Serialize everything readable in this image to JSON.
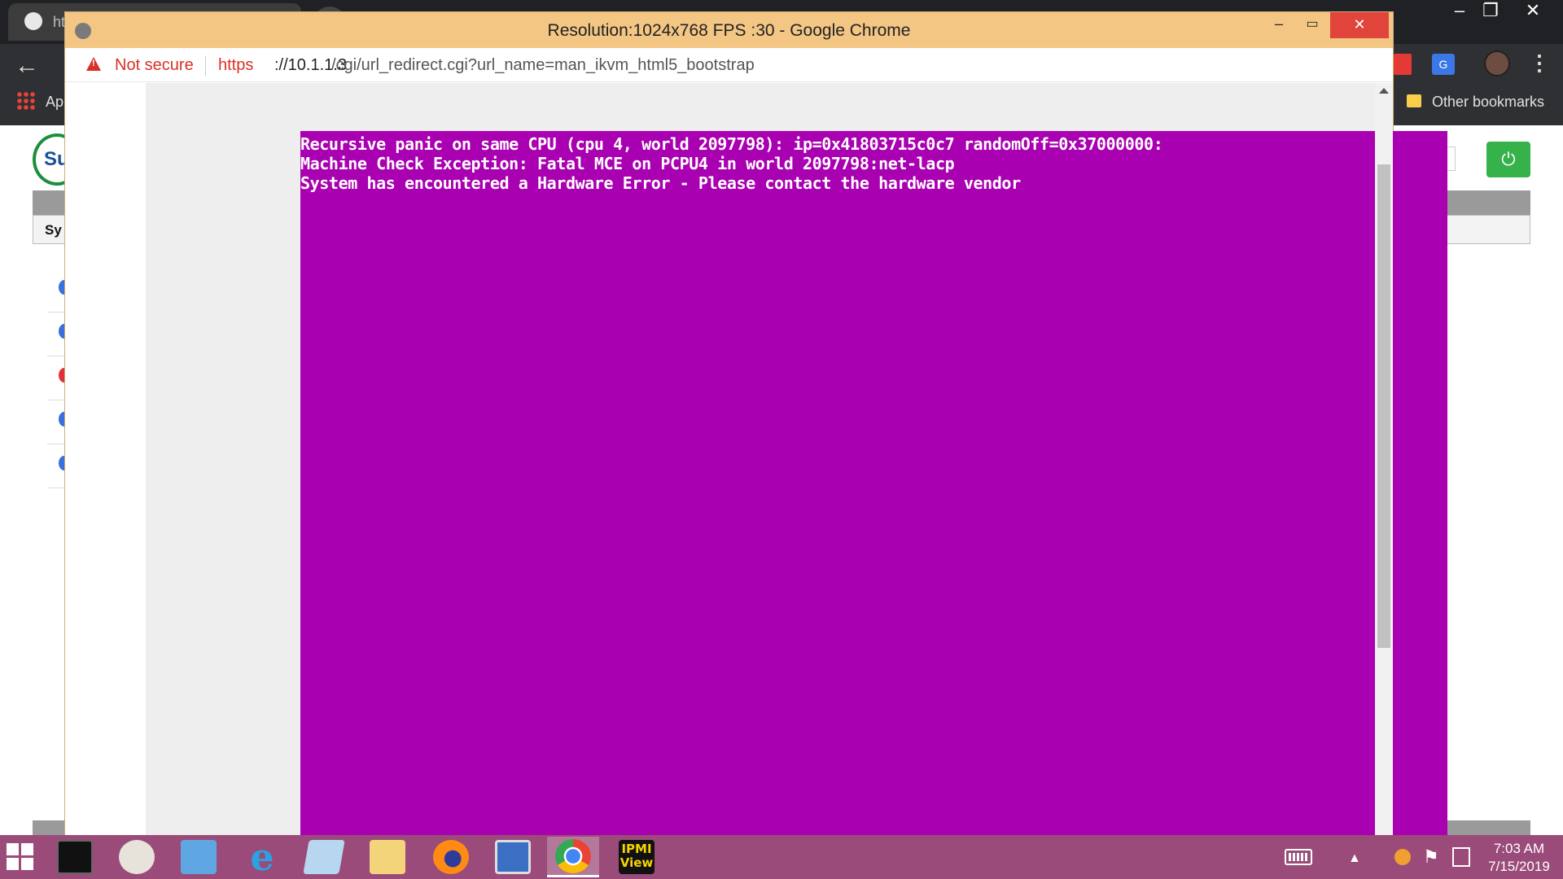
{
  "background_browser": {
    "tab_title": "ht",
    "apps_label": "Ap",
    "other_bookmarks": "Other bookmarks",
    "logo_text": "Su",
    "system_tab_label": "Sy",
    "ext_translate": "G"
  },
  "popup": {
    "title": "Resolution:1024x768 FPS :30 - Google Chrome",
    "minimize_glyph": "–",
    "maximize_glyph": "▭",
    "close_glyph": "✕",
    "security_label": "Not secure",
    "url_scheme": "https",
    "url_host": "://10.1.1.3",
    "url_path": "/cgi/url_redirect.cgi?url_name=man_ikvm_html5_bootstrap"
  },
  "console": {
    "background_color": "#a900b1",
    "text_color": "#ffffff",
    "lines": [
      "Recursive panic on same CPU (cpu 4, world 2097798): ip=0x41803715c0c7 randomOff=0x37000000:",
      "Machine Check Exception: Fatal MCE on PCPU4 in world 2097798:net-lacp",
      "System has encountered a Hardware Error - Please contact the hardware vendor"
    ]
  },
  "taskbar": {
    "apps": [
      {
        "name": "command-prompt",
        "label": ""
      },
      {
        "name": "paint",
        "label": ""
      },
      {
        "name": "remote-desktop",
        "label": ""
      },
      {
        "name": "internet-explorer",
        "label": "e"
      },
      {
        "name": "notepad",
        "label": ""
      },
      {
        "name": "file-explorer",
        "label": ""
      },
      {
        "name": "firefox",
        "label": ""
      },
      {
        "name": "network-tool",
        "label": ""
      },
      {
        "name": "chrome",
        "label": ""
      },
      {
        "name": "ipmi-view",
        "label": "IPMI View"
      }
    ],
    "active_app": "chrome",
    "time": "7:03 AM",
    "date": "7/15/2019"
  },
  "colors": {
    "taskbar": "#9a4b79",
    "popup_titlebar": "#f3c684",
    "close_button": "#e0443a",
    "not_secure": "#d93025",
    "power_button": "#35b24a"
  }
}
